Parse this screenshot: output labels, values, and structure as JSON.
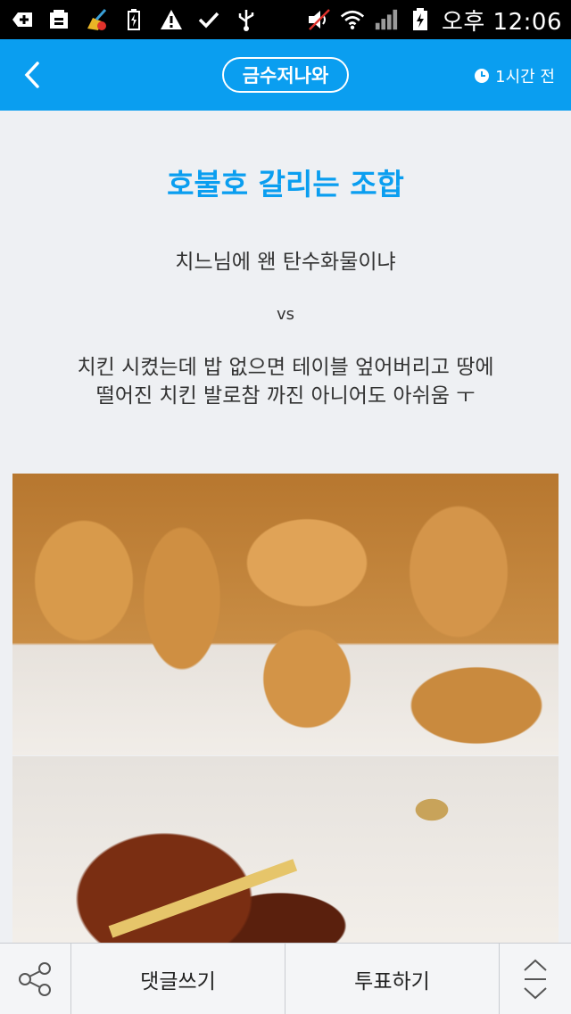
{
  "status_bar": {
    "time": "오후 12:06",
    "icons": [
      "add-icon",
      "storage-icon",
      "cleaner-icon",
      "battery-icon",
      "warning-icon",
      "check-icon",
      "usb-icon",
      "mute-icon",
      "wifi-icon",
      "signal-icon",
      "battery-charging-icon"
    ]
  },
  "app_bar": {
    "back_icon": "chevron-left-icon",
    "category": "금수저나와",
    "time_ago": "1시간 전",
    "clock_icon": "clock-icon",
    "accent": "#0a9ef0"
  },
  "post": {
    "headline": "호불호 갈리는 조합",
    "line1": "치느님에 왠 탄수화물이냐",
    "vs": "vs",
    "paragraph": [
      "치킨 시켰는데 밥 없으면 테이블 엎어버리고 땅에",
      "떨어진 치킨 발로참 까진 아니어도 아쉬움 ㅜ"
    ],
    "images": [
      "fried-chicken-photo",
      "glazed-chicken-photo"
    ]
  },
  "bottom_bar": {
    "share_icon": "share-icon",
    "comment_label": "댓글쓰기",
    "vote_label": "투표하기",
    "updown_icon": "scroll-updown-icon"
  }
}
